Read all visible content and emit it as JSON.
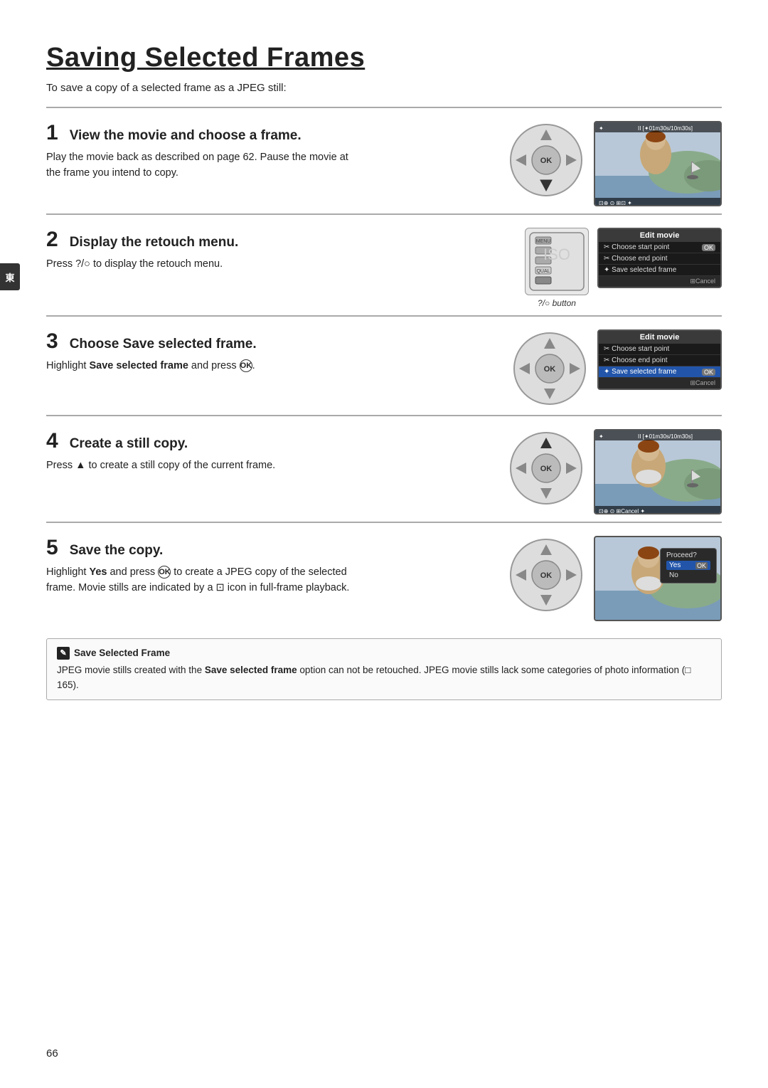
{
  "page": {
    "title": "Saving Selected Frames",
    "intro": "To save a copy of a selected frame as a JPEG still:",
    "page_number": "66"
  },
  "steps": [
    {
      "number": "1",
      "title": "View the movie and choose a frame.",
      "body": "Play the movie back as described on page 62.  Pause the movie at the frame you intend to copy.",
      "has_dpad": true,
      "has_photo": true,
      "has_menu": false
    },
    {
      "number": "2",
      "title": "Display the retouch menu.",
      "body": "Press ?/○ to display the retouch menu.",
      "has_dpad": false,
      "has_camera_buttons": true,
      "has_menu": true,
      "button_caption": "?/○ button",
      "menu_title": "Edit movie",
      "menu_items": [
        {
          "icon": "✂",
          "label": "Choose start point",
          "ok": true,
          "highlighted": false
        },
        {
          "icon": "✂",
          "label": "Choose end point",
          "ok": false,
          "highlighted": false
        },
        {
          "icon": "✦",
          "label": "Save selected frame",
          "ok": false,
          "highlighted": false
        }
      ]
    },
    {
      "number": "3",
      "title": "Choose Save selected frame.",
      "body_pre": "Highlight ",
      "body_bold": "Save selected frame",
      "body_post": " and press OK.",
      "has_dpad": true,
      "has_photo": false,
      "has_menu": true,
      "menu_title": "Edit movie",
      "menu_items": [
        {
          "icon": "✂",
          "label": "Choose start point",
          "ok": false,
          "highlighted": false
        },
        {
          "icon": "✂",
          "label": "Choose end point",
          "ok": false,
          "highlighted": false
        },
        {
          "icon": "✦",
          "label": "Save selected frame",
          "ok": true,
          "highlighted": true
        }
      ]
    },
    {
      "number": "4",
      "title": "Create a still copy.",
      "body": "Press ▲ to create a still copy of the current frame.",
      "has_dpad": true,
      "has_photo": true,
      "dpad_up_active": true
    },
    {
      "number": "5",
      "title": "Save the copy.",
      "body": "Highlight Yes and press OK to create a JPEG copy of the selected frame.  Movie stills are indicated by a ⊡ icon in full-frame playback.",
      "has_dpad": true,
      "has_photo": true,
      "show_proceed": true
    }
  ],
  "note": {
    "icon": "✎",
    "title": "Save Selected Frame",
    "body_pre": "JPEG movie stills created with the ",
    "body_bold": "Save selected frame",
    "body_post": " option can not be retouched.  JPEG movie stills lack some categories of photo information (□ 165)."
  },
  "side_tab": {
    "label": "東"
  }
}
